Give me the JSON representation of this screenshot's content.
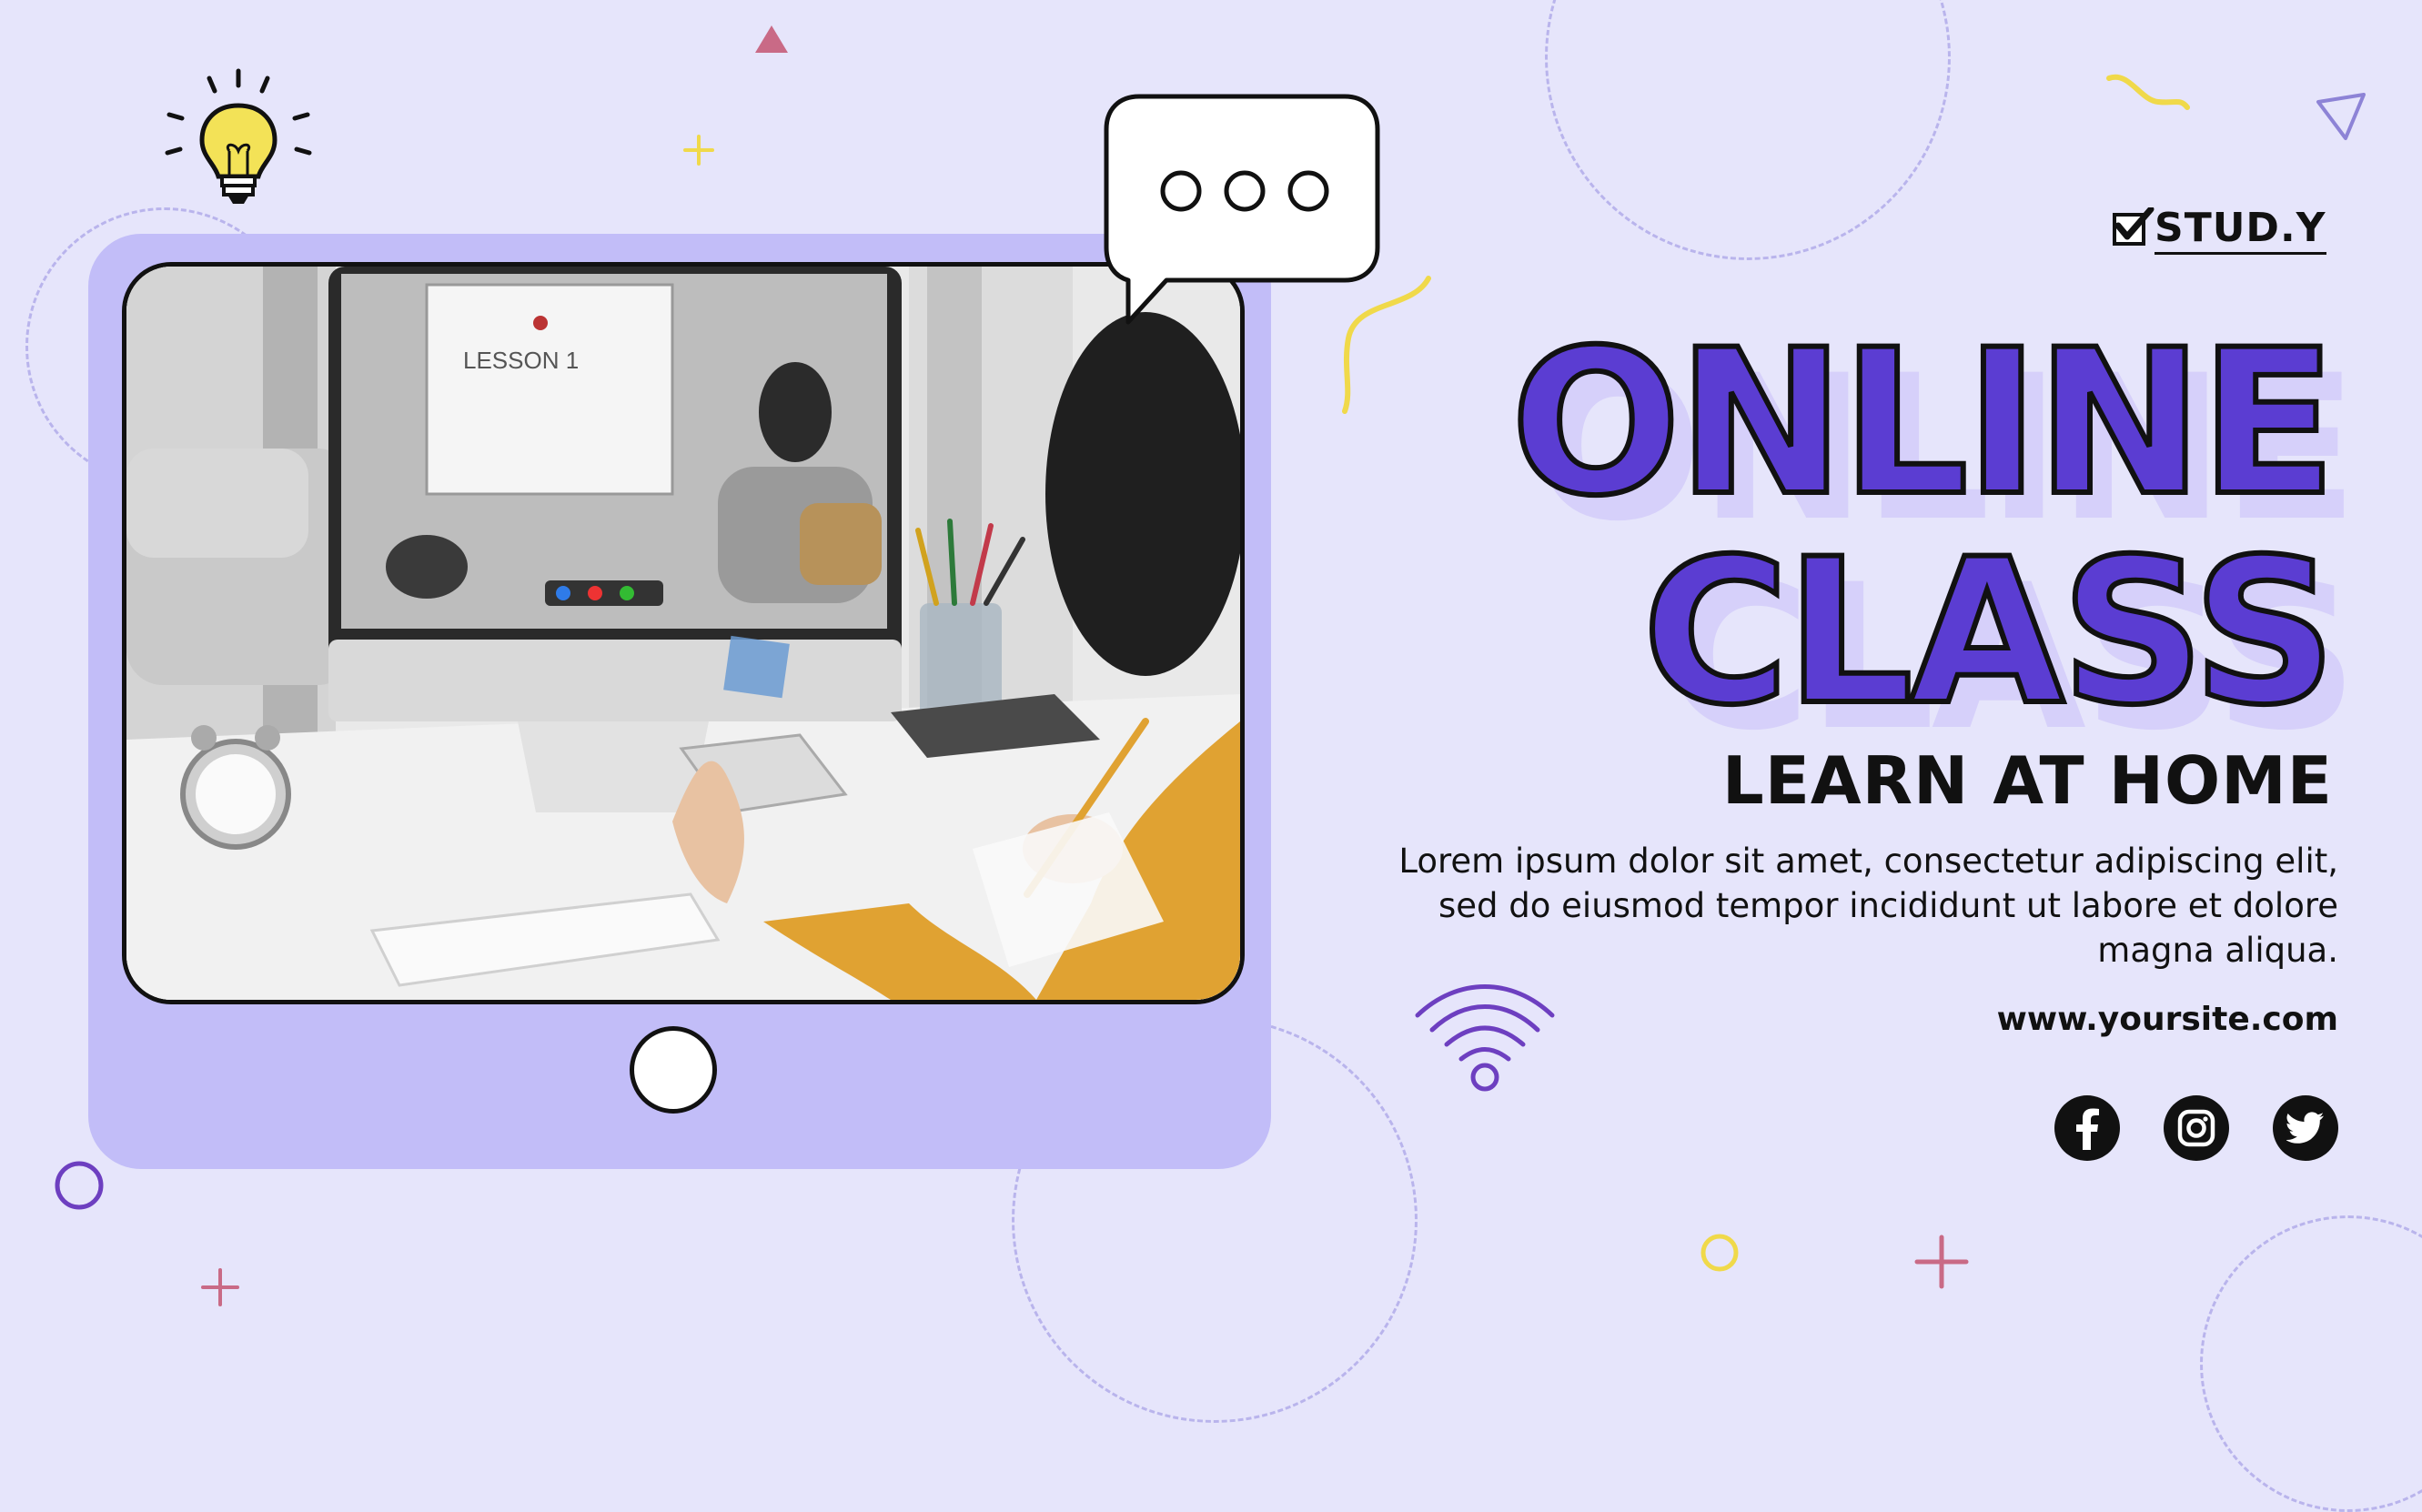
{
  "brand": {
    "name": "STUD.Y"
  },
  "headline": {
    "line1": "ONLINE",
    "line2": "CLASS"
  },
  "subheadline": "LEARN AT HOME",
  "body": {
    "line1": "Lorem ipsum dolor sit amet, consectetur adipiscing elit,",
    "line2": "sed do eiusmod tempor incididunt ut labore et dolore",
    "line3": "magna aliqua."
  },
  "website": "www.yoursite.com",
  "photo": {
    "whiteboard_text": "LESSON 1"
  },
  "social": [
    "facebook-icon",
    "instagram-icon",
    "twitter-icon"
  ],
  "colors": {
    "background": "#e6e5fb",
    "accent_purple": "#5b3dd2",
    "tablet_frame": "#c2bdf8",
    "highlight_yellow": "#f3e257",
    "pink": "#c96a86",
    "text": "#111111"
  }
}
